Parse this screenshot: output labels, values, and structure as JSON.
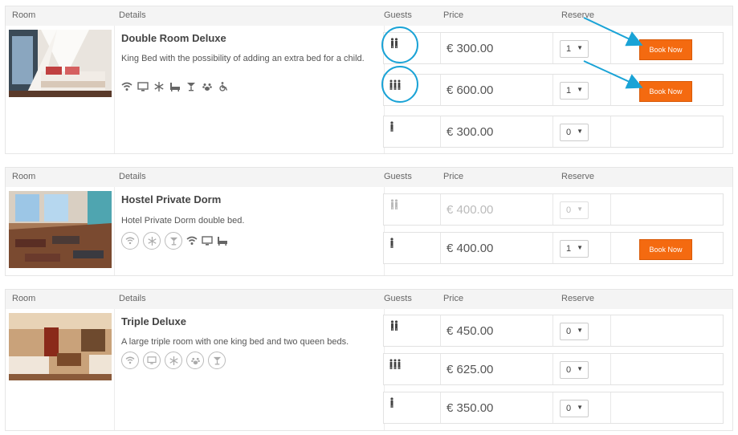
{
  "headers": {
    "room": "Room",
    "details": "Details",
    "guests": "Guests",
    "price": "Price",
    "reserve": "Reserve"
  },
  "book_label": "Book Now",
  "accent_color": "#f46a10",
  "highlight_color": "#1aa3d6",
  "rooms": [
    {
      "name": "Double Room Deluxe",
      "description": "King Bed with the possibility of adding an extra bed for a child.",
      "amenities": [
        "wifi-icon",
        "tv-icon",
        "snowflake-icon",
        "bathtub-icon",
        "cocktail-icon",
        "pet-paw-icon",
        "wheelchair-icon"
      ],
      "options": [
        {
          "guests": 2,
          "price": "€ 300.00",
          "qty": "1",
          "bookable": true,
          "disabled": false
        },
        {
          "guests": 3,
          "price": "€ 600.00",
          "qty": "1",
          "bookable": true,
          "disabled": false
        },
        {
          "guests": 1,
          "price": "€ 300.00",
          "qty": "0",
          "bookable": false,
          "disabled": false
        }
      ]
    },
    {
      "name": "Hostel Private Dorm",
      "description": "Hotel Private Dorm double bed.",
      "amenities": [
        "wifi-circle-icon",
        "snowflake-circle-icon",
        "cocktail-circle-icon",
        "wifi-icon",
        "tv-icon",
        "bathtub-icon"
      ],
      "options": [
        {
          "guests": 2,
          "price": "€ 400.00",
          "qty": "0",
          "bookable": false,
          "disabled": true
        },
        {
          "guests": 1,
          "price": "€ 400.00",
          "qty": "1",
          "bookable": true,
          "disabled": false
        }
      ]
    },
    {
      "name": "Triple Deluxe",
      "description": "A large triple room with one king bed and two queen beds.",
      "amenities": [
        "wifi-circle-icon",
        "tv-circle-icon",
        "snowflake-circle-icon",
        "pet-paw-circle-icon",
        "cocktail-circle-icon"
      ],
      "options": [
        {
          "guests": 2,
          "price": "€ 450.00",
          "qty": "0",
          "bookable": false,
          "disabled": false
        },
        {
          "guests": 3,
          "price": "€ 625.00",
          "qty": "0",
          "bookable": false,
          "disabled": false
        },
        {
          "guests": 1,
          "price": "€ 350.00",
          "qty": "0",
          "bookable": false,
          "disabled": false
        }
      ]
    }
  ]
}
